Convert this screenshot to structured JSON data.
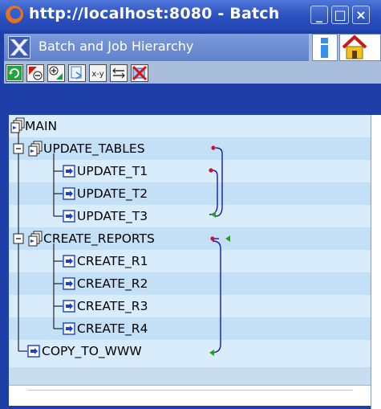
{
  "window": {
    "title": "http://localhost:8080 - Batch",
    "minimize_label": "_",
    "maximize_label": "□",
    "close_label": "×"
  },
  "app": {
    "title": "Batch and Job Hierarchy",
    "info_icon": "info-icon",
    "home_icon": "home-icon"
  },
  "toolbar": {
    "buttons": [
      "refresh-icon",
      "collapse-icon",
      "expand-icon",
      "copy-icon",
      "xy-icon",
      "toggle-icon",
      "delete-icon"
    ],
    "xy_label": "x-y"
  },
  "tree": {
    "nodes": [
      {
        "label": "MAIN"
      },
      {
        "label": "UPDATE_TABLES"
      },
      {
        "label": "UPDATE_T1"
      },
      {
        "label": "UPDATE_T2"
      },
      {
        "label": "UPDATE_T3"
      },
      {
        "label": "CREATE_REPORTS"
      },
      {
        "label": "CREATE_R1"
      },
      {
        "label": "CREATE_R2"
      },
      {
        "label": "CREATE_R3"
      },
      {
        "label": "CREATE_R4"
      },
      {
        "label": "COPY_TO_WWW"
      }
    ]
  },
  "colors": {
    "titlebar": "#2a50c0",
    "header": "#6f8fd3",
    "tree_row": "#d8ecfb",
    "tree_row_alt": "#c4e0f7",
    "dependency_line": "#1a1aa0",
    "dependency_start": "#cc1030",
    "dependency_end": "#2a9a2a"
  }
}
